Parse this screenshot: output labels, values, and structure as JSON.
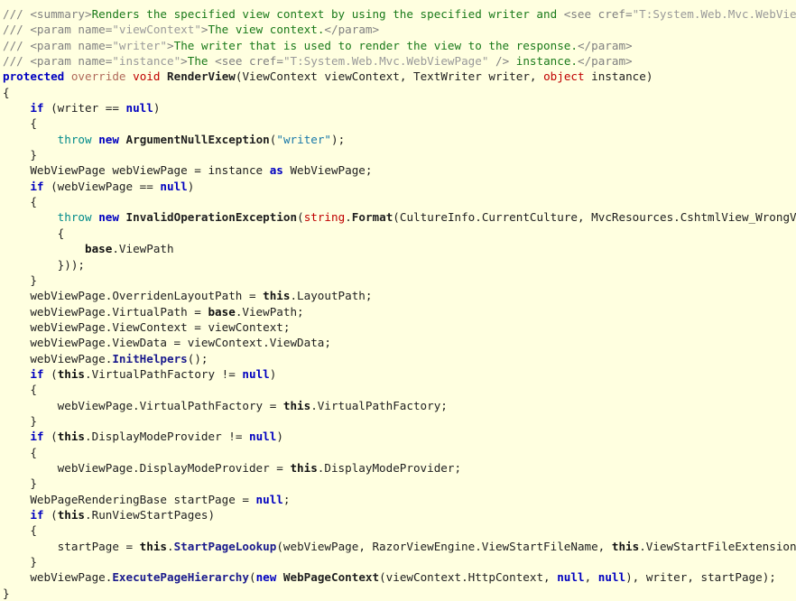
{
  "editor": {
    "background_color": "#ffffe0",
    "language": "csharp",
    "font_size_px": 12.6,
    "line_height_px": 17.35
  },
  "palette": {
    "plain": "#202020",
    "keyword": "#0000c0",
    "type_keyword": "#c00000",
    "modifier": "#b06a5a",
    "this_base": "#101010",
    "identifier_bold": "#202020",
    "method_call": "#1a1a8c",
    "throw_keyword": "#008a8a",
    "string_literal": "#1878a8",
    "comment_markup": "#808080",
    "comment_text": "#1a7a1a",
    "comment_attr_value": "#9a9a9a"
  },
  "code": {
    "lines": [
      {
        "id": "line-1",
        "tokens": [
          {
            "text": "/// ",
            "cls": "t-cmt"
          },
          {
            "text": "<summary>",
            "cls": "t-cmt"
          },
          {
            "text": "Renders the specified view context by using the specified writer and ",
            "cls": "t-cmt-txt"
          },
          {
            "text": "<see cref=",
            "cls": "t-cmt"
          },
          {
            "text": "\"T:System.Web.Mvc.WebViewPage\"",
            "cls": "t-cmt-val"
          },
          {
            "text": " />",
            "cls": "t-cmt"
          }
        ]
      },
      {
        "id": "line-2",
        "tokens": [
          {
            "text": "/// ",
            "cls": "t-cmt"
          },
          {
            "text": "<param name=",
            "cls": "t-cmt"
          },
          {
            "text": "\"viewContext\"",
            "cls": "t-cmt-val"
          },
          {
            "text": ">",
            "cls": "t-cmt"
          },
          {
            "text": "The view context.",
            "cls": "t-cmt-txt"
          },
          {
            "text": "</param>",
            "cls": "t-cmt"
          }
        ]
      },
      {
        "id": "line-3",
        "tokens": [
          {
            "text": "/// ",
            "cls": "t-cmt"
          },
          {
            "text": "<param name=",
            "cls": "t-cmt"
          },
          {
            "text": "\"writer\"",
            "cls": "t-cmt-val"
          },
          {
            "text": ">",
            "cls": "t-cmt"
          },
          {
            "text": "The writer that is used to render the view to the response.",
            "cls": "t-cmt-txt"
          },
          {
            "text": "</param>",
            "cls": "t-cmt"
          }
        ]
      },
      {
        "id": "line-4",
        "tokens": [
          {
            "text": "/// ",
            "cls": "t-cmt"
          },
          {
            "text": "<param name=",
            "cls": "t-cmt"
          },
          {
            "text": "\"instance\"",
            "cls": "t-cmt-val"
          },
          {
            "text": ">",
            "cls": "t-cmt"
          },
          {
            "text": "The ",
            "cls": "t-cmt-txt"
          },
          {
            "text": "<see cref=",
            "cls": "t-cmt"
          },
          {
            "text": "\"T:System.Web.Mvc.WebViewPage\"",
            "cls": "t-cmt-val"
          },
          {
            "text": " />",
            "cls": "t-cmt"
          },
          {
            "text": " instance.",
            "cls": "t-cmt-txt"
          },
          {
            "text": "</param>",
            "cls": "t-cmt"
          }
        ]
      },
      {
        "id": "line-5",
        "tokens": [
          {
            "text": "protected",
            "cls": "t-kw"
          },
          {
            "text": " ",
            "cls": "t-plain"
          },
          {
            "text": "override",
            "cls": "t-mod"
          },
          {
            "text": " ",
            "cls": "t-plain"
          },
          {
            "text": "void",
            "cls": "t-type"
          },
          {
            "text": " ",
            "cls": "t-plain"
          },
          {
            "text": "RenderView",
            "cls": "t-ident-b"
          },
          {
            "text": "(ViewContext viewContext, TextWriter writer, ",
            "cls": "t-plain"
          },
          {
            "text": "object",
            "cls": "t-type"
          },
          {
            "text": " instance)",
            "cls": "t-plain"
          }
        ]
      },
      {
        "id": "line-6",
        "tokens": [
          {
            "text": "{",
            "cls": "t-plain"
          }
        ]
      },
      {
        "id": "line-7",
        "tokens": [
          {
            "text": "    ",
            "cls": "t-plain"
          },
          {
            "text": "if",
            "cls": "t-kw"
          },
          {
            "text": " (writer == ",
            "cls": "t-plain"
          },
          {
            "text": "null",
            "cls": "t-kw"
          },
          {
            "text": ")",
            "cls": "t-plain"
          }
        ]
      },
      {
        "id": "line-8",
        "tokens": [
          {
            "text": "    {",
            "cls": "t-plain"
          }
        ]
      },
      {
        "id": "line-9",
        "tokens": [
          {
            "text": "        ",
            "cls": "t-plain"
          },
          {
            "text": "throw",
            "cls": "t-throw"
          },
          {
            "text": " ",
            "cls": "t-plain"
          },
          {
            "text": "new",
            "cls": "t-kw"
          },
          {
            "text": " ",
            "cls": "t-plain"
          },
          {
            "text": "ArgumentNullException",
            "cls": "t-ident-b"
          },
          {
            "text": "(",
            "cls": "t-plain"
          },
          {
            "text": "\"writer\"",
            "cls": "t-str"
          },
          {
            "text": ");",
            "cls": "t-plain"
          }
        ]
      },
      {
        "id": "line-10",
        "tokens": [
          {
            "text": "    }",
            "cls": "t-plain"
          }
        ]
      },
      {
        "id": "line-11",
        "tokens": [
          {
            "text": "    WebViewPage webViewPage = instance ",
            "cls": "t-plain"
          },
          {
            "text": "as",
            "cls": "t-kw"
          },
          {
            "text": " WebViewPage;",
            "cls": "t-plain"
          }
        ]
      },
      {
        "id": "line-12",
        "tokens": [
          {
            "text": "    ",
            "cls": "t-plain"
          },
          {
            "text": "if",
            "cls": "t-kw"
          },
          {
            "text": " (webViewPage == ",
            "cls": "t-plain"
          },
          {
            "text": "null",
            "cls": "t-kw"
          },
          {
            "text": ")",
            "cls": "t-plain"
          }
        ]
      },
      {
        "id": "line-13",
        "tokens": [
          {
            "text": "    {",
            "cls": "t-plain"
          }
        ]
      },
      {
        "id": "line-14",
        "tokens": [
          {
            "text": "        ",
            "cls": "t-plain"
          },
          {
            "text": "throw",
            "cls": "t-throw"
          },
          {
            "text": " ",
            "cls": "t-plain"
          },
          {
            "text": "new",
            "cls": "t-kw"
          },
          {
            "text": " ",
            "cls": "t-plain"
          },
          {
            "text": "InvalidOperationException",
            "cls": "t-ident-b"
          },
          {
            "text": "(",
            "cls": "t-plain"
          },
          {
            "text": "string",
            "cls": "t-type"
          },
          {
            "text": ".",
            "cls": "t-plain"
          },
          {
            "text": "Format",
            "cls": "t-ident-b"
          },
          {
            "text": "(CultureInfo.CurrentCulture, MvcResources.CshtmlView_WrongViewBase,",
            "cls": "t-plain"
          }
        ]
      },
      {
        "id": "line-15",
        "tokens": [
          {
            "text": "        {",
            "cls": "t-plain"
          }
        ]
      },
      {
        "id": "line-16",
        "tokens": [
          {
            "text": "            ",
            "cls": "t-plain"
          },
          {
            "text": "base",
            "cls": "t-thisbase"
          },
          {
            "text": ".ViewPath",
            "cls": "t-plain"
          }
        ]
      },
      {
        "id": "line-17",
        "tokens": [
          {
            "text": "        }));",
            "cls": "t-plain"
          }
        ]
      },
      {
        "id": "line-18",
        "tokens": [
          {
            "text": "    }",
            "cls": "t-plain"
          }
        ]
      },
      {
        "id": "line-19",
        "tokens": [
          {
            "text": "    webViewPage.OverridenLayoutPath = ",
            "cls": "t-plain"
          },
          {
            "text": "this",
            "cls": "t-thisbase"
          },
          {
            "text": ".LayoutPath;",
            "cls": "t-plain"
          }
        ]
      },
      {
        "id": "line-20",
        "tokens": [
          {
            "text": "    webViewPage.VirtualPath = ",
            "cls": "t-plain"
          },
          {
            "text": "base",
            "cls": "t-thisbase"
          },
          {
            "text": ".ViewPath;",
            "cls": "t-plain"
          }
        ]
      },
      {
        "id": "line-21",
        "tokens": [
          {
            "text": "    webViewPage.ViewContext = viewContext;",
            "cls": "t-plain"
          }
        ]
      },
      {
        "id": "line-22",
        "tokens": [
          {
            "text": "    webViewPage.ViewData = viewContext.ViewData;",
            "cls": "t-plain"
          }
        ]
      },
      {
        "id": "line-23",
        "tokens": [
          {
            "text": "    webViewPage.",
            "cls": "t-plain"
          },
          {
            "text": "InitHelpers",
            "cls": "t-method"
          },
          {
            "text": "();",
            "cls": "t-plain"
          }
        ]
      },
      {
        "id": "line-24",
        "tokens": [
          {
            "text": "    ",
            "cls": "t-plain"
          },
          {
            "text": "if",
            "cls": "t-kw"
          },
          {
            "text": " (",
            "cls": "t-plain"
          },
          {
            "text": "this",
            "cls": "t-thisbase"
          },
          {
            "text": ".VirtualPathFactory != ",
            "cls": "t-plain"
          },
          {
            "text": "null",
            "cls": "t-kw"
          },
          {
            "text": ")",
            "cls": "t-plain"
          }
        ]
      },
      {
        "id": "line-25",
        "tokens": [
          {
            "text": "    {",
            "cls": "t-plain"
          }
        ]
      },
      {
        "id": "line-26",
        "tokens": [
          {
            "text": "        webViewPage.VirtualPathFactory = ",
            "cls": "t-plain"
          },
          {
            "text": "this",
            "cls": "t-thisbase"
          },
          {
            "text": ".VirtualPathFactory;",
            "cls": "t-plain"
          }
        ]
      },
      {
        "id": "line-27",
        "tokens": [
          {
            "text": "    }",
            "cls": "t-plain"
          }
        ]
      },
      {
        "id": "line-28",
        "tokens": [
          {
            "text": "    ",
            "cls": "t-plain"
          },
          {
            "text": "if",
            "cls": "t-kw"
          },
          {
            "text": " (",
            "cls": "t-plain"
          },
          {
            "text": "this",
            "cls": "t-thisbase"
          },
          {
            "text": ".DisplayModeProvider != ",
            "cls": "t-plain"
          },
          {
            "text": "null",
            "cls": "t-kw"
          },
          {
            "text": ")",
            "cls": "t-plain"
          }
        ]
      },
      {
        "id": "line-29",
        "tokens": [
          {
            "text": "    {",
            "cls": "t-plain"
          }
        ]
      },
      {
        "id": "line-30",
        "tokens": [
          {
            "text": "        webViewPage.DisplayModeProvider = ",
            "cls": "t-plain"
          },
          {
            "text": "this",
            "cls": "t-thisbase"
          },
          {
            "text": ".DisplayModeProvider;",
            "cls": "t-plain"
          }
        ]
      },
      {
        "id": "line-31",
        "tokens": [
          {
            "text": "    }",
            "cls": "t-plain"
          }
        ]
      },
      {
        "id": "line-32",
        "tokens": [
          {
            "text": "    WebPageRenderingBase startPage = ",
            "cls": "t-plain"
          },
          {
            "text": "null",
            "cls": "t-kw"
          },
          {
            "text": ";",
            "cls": "t-plain"
          }
        ]
      },
      {
        "id": "line-33",
        "tokens": [
          {
            "text": "    ",
            "cls": "t-plain"
          },
          {
            "text": "if",
            "cls": "t-kw"
          },
          {
            "text": " (",
            "cls": "t-plain"
          },
          {
            "text": "this",
            "cls": "t-thisbase"
          },
          {
            "text": ".RunViewStartPages)",
            "cls": "t-plain"
          }
        ]
      },
      {
        "id": "line-34",
        "tokens": [
          {
            "text": "    {",
            "cls": "t-plain"
          }
        ]
      },
      {
        "id": "line-35",
        "tokens": [
          {
            "text": "        startPage = ",
            "cls": "t-plain"
          },
          {
            "text": "this",
            "cls": "t-thisbase"
          },
          {
            "text": ".",
            "cls": "t-plain"
          },
          {
            "text": "StartPageLookup",
            "cls": "t-method"
          },
          {
            "text": "(webViewPage, RazorViewEngine.ViewStartFileName, ",
            "cls": "t-plain"
          },
          {
            "text": "this",
            "cls": "t-thisbase"
          },
          {
            "text": ".ViewStartFileExtensions);",
            "cls": "t-plain"
          }
        ]
      },
      {
        "id": "line-36",
        "tokens": [
          {
            "text": "    }",
            "cls": "t-plain"
          }
        ]
      },
      {
        "id": "line-37",
        "tokens": [
          {
            "text": "    webViewPage.",
            "cls": "t-plain"
          },
          {
            "text": "ExecutePageHierarchy",
            "cls": "t-method"
          },
          {
            "text": "(",
            "cls": "t-plain"
          },
          {
            "text": "new",
            "cls": "t-kw"
          },
          {
            "text": " ",
            "cls": "t-plain"
          },
          {
            "text": "WebPageContext",
            "cls": "t-ident-b"
          },
          {
            "text": "(viewContext.HttpContext, ",
            "cls": "t-plain"
          },
          {
            "text": "null",
            "cls": "t-kw"
          },
          {
            "text": ", ",
            "cls": "t-plain"
          },
          {
            "text": "null",
            "cls": "t-kw"
          },
          {
            "text": "), writer, startPage);",
            "cls": "t-plain"
          }
        ]
      },
      {
        "id": "line-38",
        "tokens": [
          {
            "text": "}",
            "cls": "t-plain"
          }
        ]
      }
    ]
  }
}
